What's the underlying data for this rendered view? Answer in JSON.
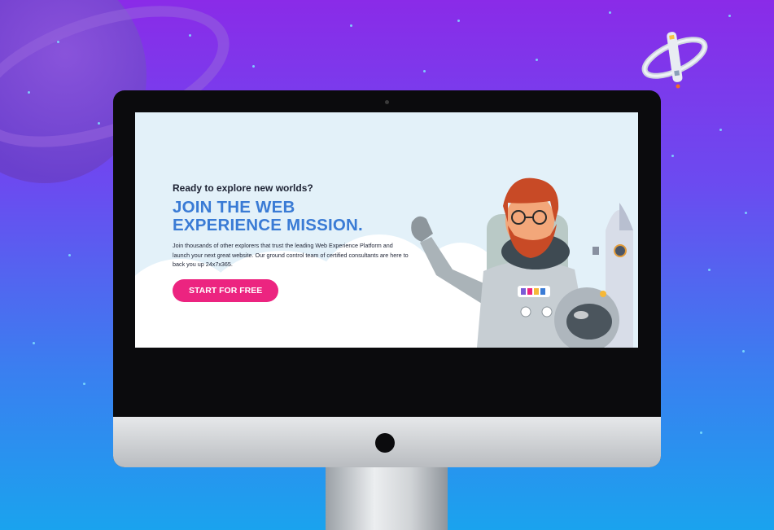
{
  "hero": {
    "kicker": "Ready to explore new worlds?",
    "headline_line1": "JOIN THE WEB",
    "headline_line2": "EXPERIENCE MISSION.",
    "body": "Join thousands of other explorers that trust the leading Web Experience Platform and launch your next great website. Our ground control team of certified consultants are here to back you up 24x7x365.",
    "cta_label": "START FOR FREE"
  },
  "colors": {
    "cta": "#ec2480",
    "headline": "#3a7bd5",
    "background_top": "#8a2be8",
    "background_bottom": "#1aa3ee"
  },
  "icons": [
    "planet-illustration",
    "space-station-illustration",
    "astronaut-illustration",
    "rocket-illustration",
    "apple-logo-icon"
  ]
}
